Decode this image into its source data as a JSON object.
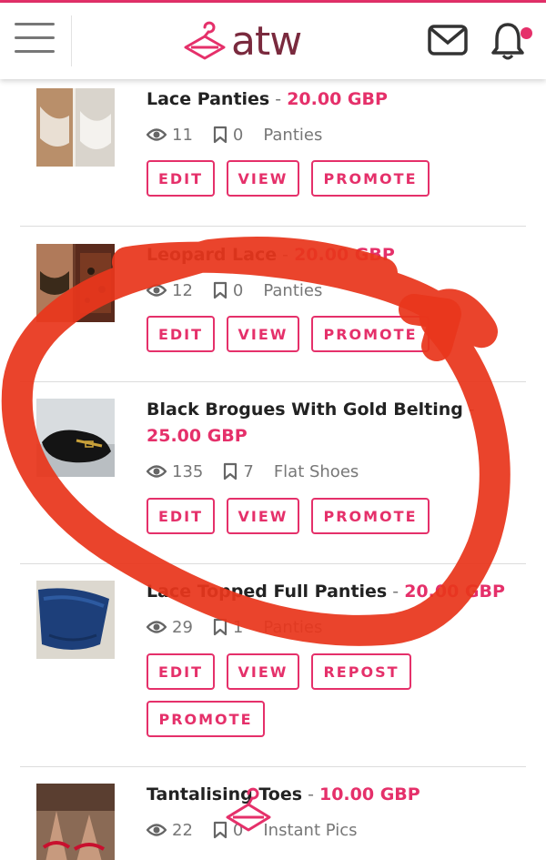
{
  "header": {
    "logo_text": "atw",
    "colors": {
      "accent": "#e5306a",
      "logo": "#7a2a3e",
      "scribble": "#e8361c"
    },
    "icons": [
      "menu-icon",
      "hanger-logo-icon",
      "mail-icon",
      "bell-icon"
    ]
  },
  "listings": [
    {
      "title": "Lace Panties",
      "price": "20.00 GBP",
      "views": "11",
      "saves": "0",
      "category": "Panties",
      "buttons": [
        "EDIT",
        "VIEW",
        "PROMOTE"
      ]
    },
    {
      "title": "Leopard Lace",
      "price": "20.00 GBP",
      "views": "12",
      "saves": "0",
      "category": "Panties",
      "buttons": [
        "EDIT",
        "VIEW",
        "PROMOTE"
      ]
    },
    {
      "title": "Black Brogues With Gold Belting",
      "price": "25.00 GBP",
      "views": "135",
      "saves": "7",
      "category": "Flat Shoes",
      "buttons": [
        "EDIT",
        "VIEW",
        "PROMOTE"
      ]
    },
    {
      "title": "Lace Topped Full Panties",
      "price": "20.00 GBP",
      "views": "29",
      "saves": "1",
      "category": "Panties",
      "buttons": [
        "EDIT",
        "VIEW",
        "REPOST",
        "PROMOTE"
      ]
    },
    {
      "title": "Tantalising Toes",
      "price": "10.00 GBP",
      "views": "22",
      "saves": "0",
      "category": "Instant Pics",
      "buttons": []
    }
  ],
  "separator": " - "
}
